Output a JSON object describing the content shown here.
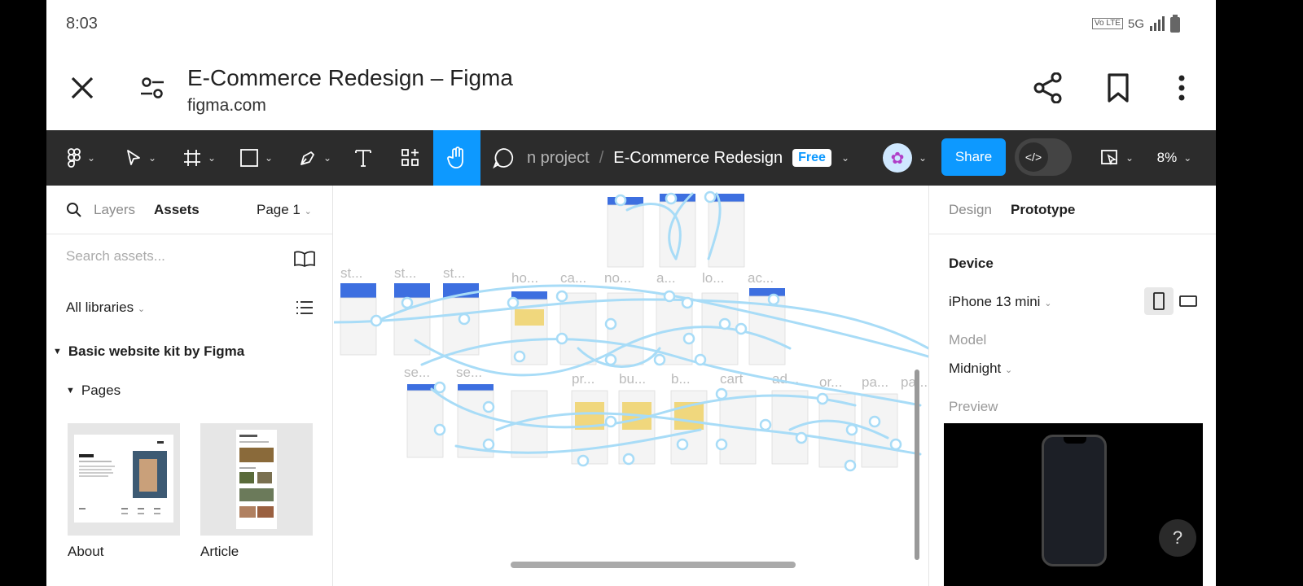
{
  "status_bar": {
    "time": "8:03",
    "network": "5G",
    "carrier_icon": "volte-icon",
    "signal_icon": "signal-bars-icon",
    "battery_icon": "battery-icon"
  },
  "browser": {
    "title": "E-Commerce Redesign – Figma",
    "url": "figma.com",
    "icons": [
      "close-icon",
      "site-settings-icon",
      "share-icon",
      "bookmark-icon",
      "more-vert-icon"
    ]
  },
  "toolbar": {
    "project_crumb": "n project",
    "separator": "/",
    "file_name": "E-Commerce Redesign",
    "plan_badge": "Free",
    "share_label": "Share",
    "zoom": "8%",
    "accent": "#0d99ff"
  },
  "left_panel": {
    "tab_layers": "Layers",
    "tab_assets": "Assets",
    "page_selector": "Page 1",
    "search_placeholder": "Search assets...",
    "libraries_filter": "All libraries",
    "kit_name": "Basic website kit by Figma",
    "pages_heading": "Pages",
    "thumbnails": [
      {
        "label": "About"
      },
      {
        "label": "Article"
      }
    ]
  },
  "canvas": {
    "frame_labels": [
      "st...",
      "st...",
      "st...",
      "ho...",
      "ca...",
      "no...",
      "a...",
      "lo...",
      "ac...",
      "se...",
      "se...",
      "pr...",
      "bu...",
      "b...",
      "cart",
      "ad...",
      "or...",
      "pa...",
      "pa..."
    ],
    "flow_color": "#a8dcf7"
  },
  "right_panel": {
    "tab_design": "Design",
    "tab_prototype": "Prototype",
    "device_heading": "Device",
    "device_value": "iPhone 13 mini",
    "model_heading": "Model",
    "model_value": "Midnight",
    "preview_heading": "Preview",
    "help_label": "?"
  }
}
